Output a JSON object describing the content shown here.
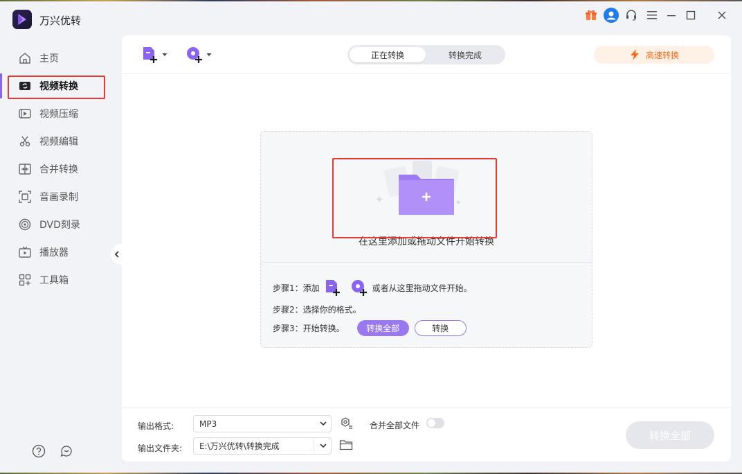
{
  "app": {
    "title": "万兴优转",
    "brand_color": "#8a63f0",
    "accent_orange": "#ff6a1a"
  },
  "window_controls": {
    "icons": [
      "gift-icon",
      "user-icon",
      "headset-icon",
      "menu-icon",
      "minimize-icon",
      "maximize-icon",
      "close-icon"
    ]
  },
  "sidebar": {
    "items": [
      {
        "label": "主页",
        "icon": "home-icon"
      },
      {
        "label": "视频转换",
        "icon": "convert-icon",
        "active": true
      },
      {
        "label": "视频压缩",
        "icon": "compress-icon"
      },
      {
        "label": "视频编辑",
        "icon": "scissors-icon"
      },
      {
        "label": "合并转换",
        "icon": "merge-icon"
      },
      {
        "label": "音画录制",
        "icon": "record-icon"
      },
      {
        "label": "DVD刻录",
        "icon": "disc-icon"
      },
      {
        "label": "播放器",
        "icon": "player-icon"
      },
      {
        "label": "工具箱",
        "icon": "toolbox-icon"
      }
    ],
    "bottom_icons": [
      "help-icon",
      "feedback-icon"
    ]
  },
  "toolbar": {
    "tabs": [
      "正在转换",
      "转换完成"
    ],
    "active_tab": "正在转换",
    "speed_label": "高速转换"
  },
  "dropzone": {
    "hint": "在这里添加或拖动文件开始转换",
    "step1_prefix": "步骤1：添加",
    "step1_suffix": "或者从这里拖动文件开始。",
    "step2": "步骤2：选择你的格式。",
    "step3": "步骤3：开始转换。",
    "convert_all_label": "转换全部",
    "convert_label": "转换"
  },
  "bottom": {
    "format_label": "输出格式:",
    "format_value": "MP3",
    "merge_label": "合并全部文件",
    "merge_enabled": false,
    "folder_label": "输出文件夹:",
    "folder_value": "E:\\万兴优转\\转换完成",
    "convert_all_label": "转换全部"
  }
}
